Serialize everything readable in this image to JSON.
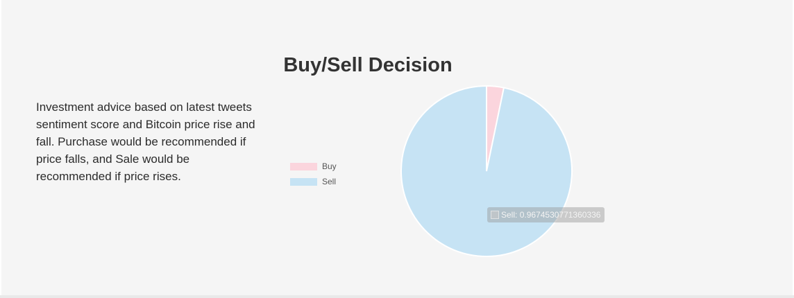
{
  "page": {
    "title": "Buy/Sell Decision",
    "description": "Investment advice based on latest tweets sentiment score and Bitcoin price rise and fall. Purchase would be recommended if price falls, and Sale would be recommended if price rises."
  },
  "chart_data": {
    "type": "pie",
    "categories": [
      "Buy",
      "Sell"
    ],
    "values": [
      0.0325469228639664,
      0.9674530771360336
    ],
    "colors": [
      "#fbd5dd",
      "#c6e3f4"
    ],
    "legend_position": "left",
    "tooltip": {
      "label": "Sell",
      "value": "0.9674530771360336"
    }
  }
}
